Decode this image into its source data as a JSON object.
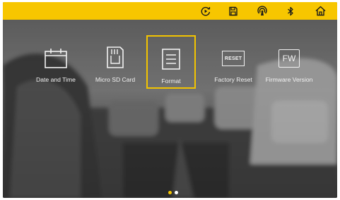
{
  "status_bar": {
    "background": "#f7c600",
    "icons": [
      "replay-icon",
      "save-icon",
      "wifi-hotspot-icon",
      "bluetooth-icon",
      "home-icon"
    ]
  },
  "menu": {
    "items": [
      {
        "label": "Date and Time",
        "icon": "calendar-icon"
      },
      {
        "label": "Micro SD Card",
        "icon": "sd-card-icon"
      },
      {
        "label": "Format",
        "icon": "format-icon"
      },
      {
        "label": "Factory Reset",
        "icon": "reset-icon",
        "badge": "RESET"
      },
      {
        "label": "Firmware Version",
        "icon": "firmware-icon",
        "badge": "FW"
      }
    ],
    "selected_label": "Format",
    "highlight_color": "#f3c400"
  },
  "pagination": {
    "total": 2,
    "current": 1,
    "active_color": "#f7c600",
    "inactive_color": "#ffffff"
  }
}
